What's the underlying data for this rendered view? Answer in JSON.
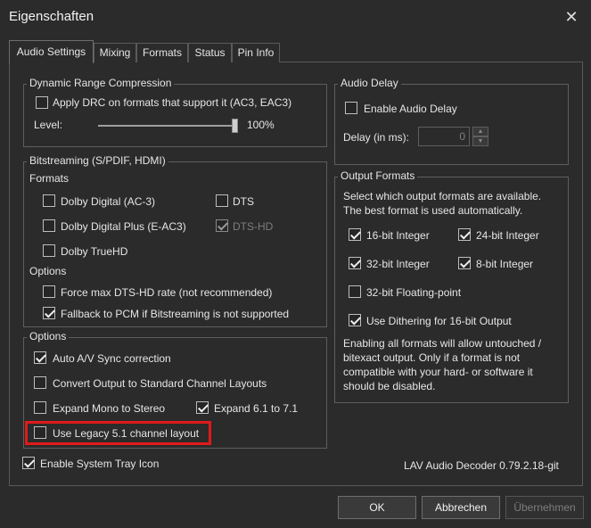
{
  "window": {
    "title": "Eigenschaften",
    "close_glyph": "✕"
  },
  "tabs": [
    "Audio Settings",
    "Mixing",
    "Formats",
    "Status",
    "Pin Info"
  ],
  "drc": {
    "legend": "Dynamic Range Compression",
    "apply_label": "Apply DRC on formats that support it (AC3, EAC3)",
    "apply_checked": false,
    "level_label": "Level:",
    "level_value": "100%",
    "level_fraction": 1.0
  },
  "bitstreaming": {
    "legend": "Bitstreaming (S/PDIF, HDMI)",
    "formats_heading": "Formats",
    "formats": [
      {
        "label": "Dolby Digital (AC-3)",
        "checked": false,
        "disabled": false
      },
      {
        "label": "DTS",
        "checked": false,
        "disabled": false
      },
      {
        "label": "Dolby Digital Plus (E-AC3)",
        "checked": false,
        "disabled": false
      },
      {
        "label": "DTS-HD",
        "checked": true,
        "disabled": true
      },
      {
        "label": "Dolby TrueHD",
        "checked": false,
        "disabled": false
      }
    ],
    "options_heading": "Options",
    "options": [
      {
        "label": "Force max DTS-HD rate (not recommended)",
        "checked": false
      },
      {
        "label": "Fallback to PCM if Bitstreaming is not supported",
        "checked": true
      }
    ]
  },
  "options": {
    "legend": "Options",
    "items": [
      {
        "label": "Auto A/V Sync correction",
        "checked": true
      },
      {
        "label": "Convert Output to Standard Channel Layouts",
        "checked": false
      },
      {
        "label": "Expand Mono to Stereo",
        "checked": false
      },
      {
        "label": "Expand 6.1 to 7.1",
        "checked": true
      },
      {
        "label": "Use Legacy 5.1 channel layout",
        "checked": false
      }
    ]
  },
  "audio_delay": {
    "legend": "Audio Delay",
    "enable_label": "Enable Audio Delay",
    "enable_checked": false,
    "delay_label": "Delay (in ms):",
    "delay_value": "0",
    "up_glyph": "▲",
    "down_glyph": "▼"
  },
  "output_formats": {
    "legend": "Output Formats",
    "description_lines": [
      "Select which output formats are available.",
      "The best format is used automatically."
    ],
    "formats": [
      {
        "label": "16-bit Integer",
        "checked": true
      },
      {
        "label": "24-bit Integer",
        "checked": true
      },
      {
        "label": "32-bit Integer",
        "checked": true
      },
      {
        "label": "8-bit Integer",
        "checked": true
      },
      {
        "label": "32-bit Floating-point",
        "checked": false
      }
    ],
    "dithering_label": "Use Dithering for 16-bit Output",
    "dithering_checked": true,
    "note_lines": [
      "Enabling all formats will allow untouched /",
      "bitexact output. Only if a format is not",
      "compatible with your hard- or software it",
      "should be disabled."
    ]
  },
  "tray": {
    "label": "Enable System Tray Icon",
    "checked": true
  },
  "version": "LAV Audio Decoder 0.79.2.18-git",
  "buttons": {
    "ok": "OK",
    "cancel": "Abbrechen",
    "apply": "Übernehmen"
  },
  "colors": {
    "background": "#2b2b2b",
    "highlight": "#e01a1a",
    "text": "#e6e6e6"
  }
}
